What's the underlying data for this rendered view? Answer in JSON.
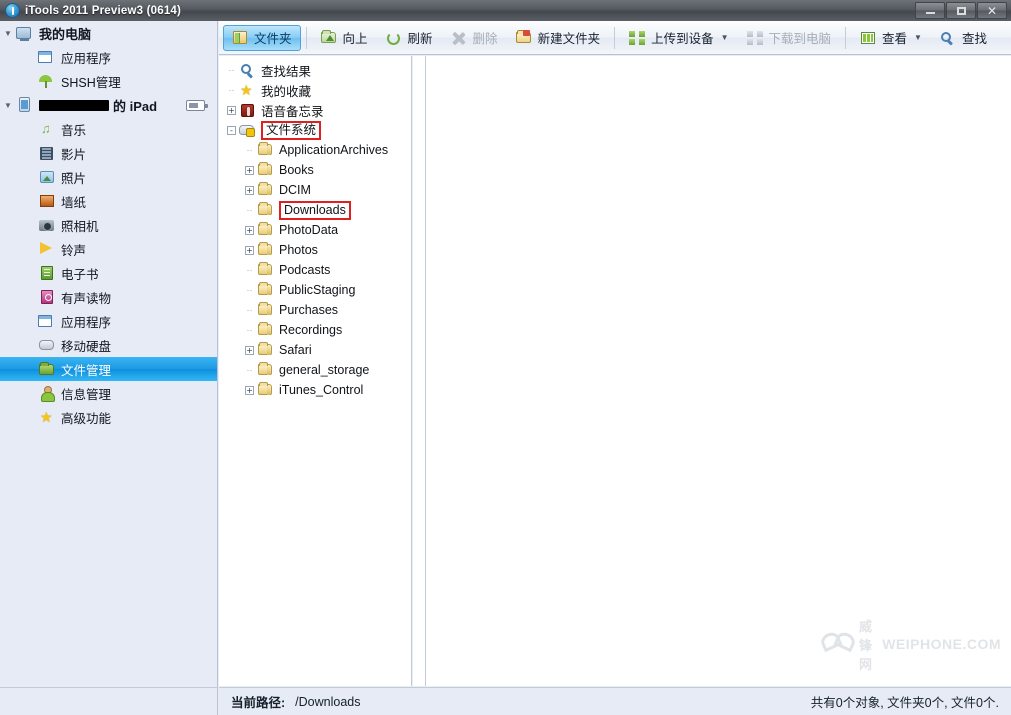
{
  "window": {
    "title": "iTools 2011 Preview3 (0614)",
    "app_icon": "itools-globe-icon",
    "controls": {
      "minimize": "_",
      "maximize": "□",
      "close": "✕"
    }
  },
  "sidebar": {
    "items": [
      {
        "label": "我的电脑",
        "icon": "computer-icon",
        "level": 0,
        "expander": "▼",
        "type": "root"
      },
      {
        "label": "应用程序",
        "icon": "application-icon",
        "level": 1,
        "expander": "",
        "type": "child"
      },
      {
        "label": "SHSH管理",
        "icon": "umbrella-icon",
        "level": 1,
        "expander": "",
        "type": "child"
      },
      {
        "label": "的 iPad",
        "icon": "ipad-icon",
        "level": 0,
        "expander": "▼",
        "type": "device",
        "redacted": true,
        "battery": true
      },
      {
        "label": "音乐",
        "icon": "music-note-icon",
        "level": 1,
        "expander": "",
        "type": "child"
      },
      {
        "label": "影片",
        "icon": "film-icon",
        "level": 1,
        "expander": "",
        "type": "child"
      },
      {
        "label": "照片",
        "icon": "photo-icon",
        "level": 1,
        "expander": "",
        "type": "child"
      },
      {
        "label": "墙纸",
        "icon": "wallpaper-icon",
        "level": 1,
        "expander": "",
        "type": "child"
      },
      {
        "label": "照相机",
        "icon": "camera-icon",
        "level": 1,
        "expander": "",
        "type": "child"
      },
      {
        "label": "铃声",
        "icon": "ringtone-icon",
        "level": 1,
        "expander": "",
        "type": "child"
      },
      {
        "label": "电子书",
        "icon": "ebook-icon",
        "level": 1,
        "expander": "",
        "type": "child"
      },
      {
        "label": "有声读物",
        "icon": "audiobook-icon",
        "level": 1,
        "expander": "",
        "type": "child"
      },
      {
        "label": "应用程序",
        "icon": "application-icon",
        "level": 1,
        "expander": "",
        "type": "child"
      },
      {
        "label": "移动硬盘",
        "icon": "harddisk-icon",
        "level": 1,
        "expander": "",
        "type": "child"
      },
      {
        "label": "文件管理",
        "icon": "folder-icon",
        "level": 1,
        "expander": "",
        "type": "child",
        "selected": true
      },
      {
        "label": "信息管理",
        "icon": "contacts-icon",
        "level": 1,
        "expander": "",
        "type": "child"
      },
      {
        "label": "高级功能",
        "icon": "star-icon",
        "level": 1,
        "expander": "",
        "type": "child"
      }
    ]
  },
  "toolbar": {
    "buttons": [
      {
        "label": "文件夹",
        "icon": "folder-view-icon",
        "active": true,
        "disabled": false,
        "caret": false
      },
      {
        "label": "向上",
        "icon": "up-folder-icon",
        "active": false,
        "disabled": false,
        "caret": false
      },
      {
        "label": "刷新",
        "icon": "refresh-icon",
        "active": false,
        "disabled": false,
        "caret": false
      },
      {
        "label": "删除",
        "icon": "delete-icon",
        "active": false,
        "disabled": true,
        "caret": false
      },
      {
        "label": "新建文件夹",
        "icon": "new-folder-icon",
        "active": false,
        "disabled": false,
        "caret": false
      },
      {
        "label": "上传到设备",
        "icon": "upload-icon",
        "active": false,
        "disabled": false,
        "caret": true
      },
      {
        "label": "下载到电脑",
        "icon": "download-icon",
        "active": false,
        "disabled": true,
        "caret": false
      },
      {
        "label": "查看",
        "icon": "view-grid-icon",
        "active": false,
        "disabled": false,
        "caret": true
      },
      {
        "label": "查找",
        "icon": "search-icon",
        "active": false,
        "disabled": false,
        "caret": false
      }
    ],
    "caret_glyph": "▼"
  },
  "tree": {
    "nodes": [
      {
        "label": "查找结果",
        "icon": "search-result-icon",
        "level": 0,
        "expander": "none",
        "highlight": false
      },
      {
        "label": "我的收藏",
        "icon": "favorites-star-icon",
        "level": 0,
        "expander": "none",
        "highlight": false
      },
      {
        "label": "语音备忘录",
        "icon": "voice-memo-icon",
        "level": 0,
        "expander": "+",
        "highlight": false
      },
      {
        "label": "文件系统",
        "icon": "filesystem-icon",
        "level": 0,
        "expander": "-",
        "highlight": true
      },
      {
        "label": "ApplicationArchives",
        "icon": "folder-icon",
        "level": 1,
        "expander": "none",
        "highlight": false
      },
      {
        "label": "Books",
        "icon": "folder-icon",
        "level": 1,
        "expander": "+",
        "highlight": false
      },
      {
        "label": "DCIM",
        "icon": "folder-icon",
        "level": 1,
        "expander": "+",
        "highlight": false
      },
      {
        "label": "Downloads",
        "icon": "folder-icon",
        "level": 1,
        "expander": "none",
        "highlight": true
      },
      {
        "label": "PhotoData",
        "icon": "folder-icon",
        "level": 1,
        "expander": "+",
        "highlight": false
      },
      {
        "label": "Photos",
        "icon": "folder-icon",
        "level": 1,
        "expander": "+",
        "highlight": false
      },
      {
        "label": "Podcasts",
        "icon": "folder-icon",
        "level": 1,
        "expander": "none",
        "highlight": false
      },
      {
        "label": "PublicStaging",
        "icon": "folder-icon",
        "level": 1,
        "expander": "none",
        "highlight": false
      },
      {
        "label": "Purchases",
        "icon": "folder-icon",
        "level": 1,
        "expander": "none",
        "highlight": false
      },
      {
        "label": "Recordings",
        "icon": "folder-icon",
        "level": 1,
        "expander": "none",
        "highlight": false
      },
      {
        "label": "Safari",
        "icon": "folder-icon",
        "level": 1,
        "expander": "+",
        "highlight": false
      },
      {
        "label": "general_storage",
        "icon": "folder-icon",
        "level": 1,
        "expander": "none",
        "highlight": false
      },
      {
        "label": "iTunes_Control",
        "icon": "folder-icon",
        "level": 1,
        "expander": "+",
        "highlight": false
      }
    ],
    "highlight_color": "#e02020"
  },
  "content": {
    "empty": true,
    "watermark_text": "WEIPHONE.COM",
    "watermark_cn": "威锋网"
  },
  "statusbar": {
    "path_label": "当前路径:",
    "path_value": "/Downloads",
    "summary": "共有0个对象, 文件夹0个, 文件0个."
  },
  "colors": {
    "accent": "#1b9ae4",
    "sidebar_bg": "#e6ebf5",
    "highlight_red": "#e02020",
    "titlebar": "#53585e"
  }
}
